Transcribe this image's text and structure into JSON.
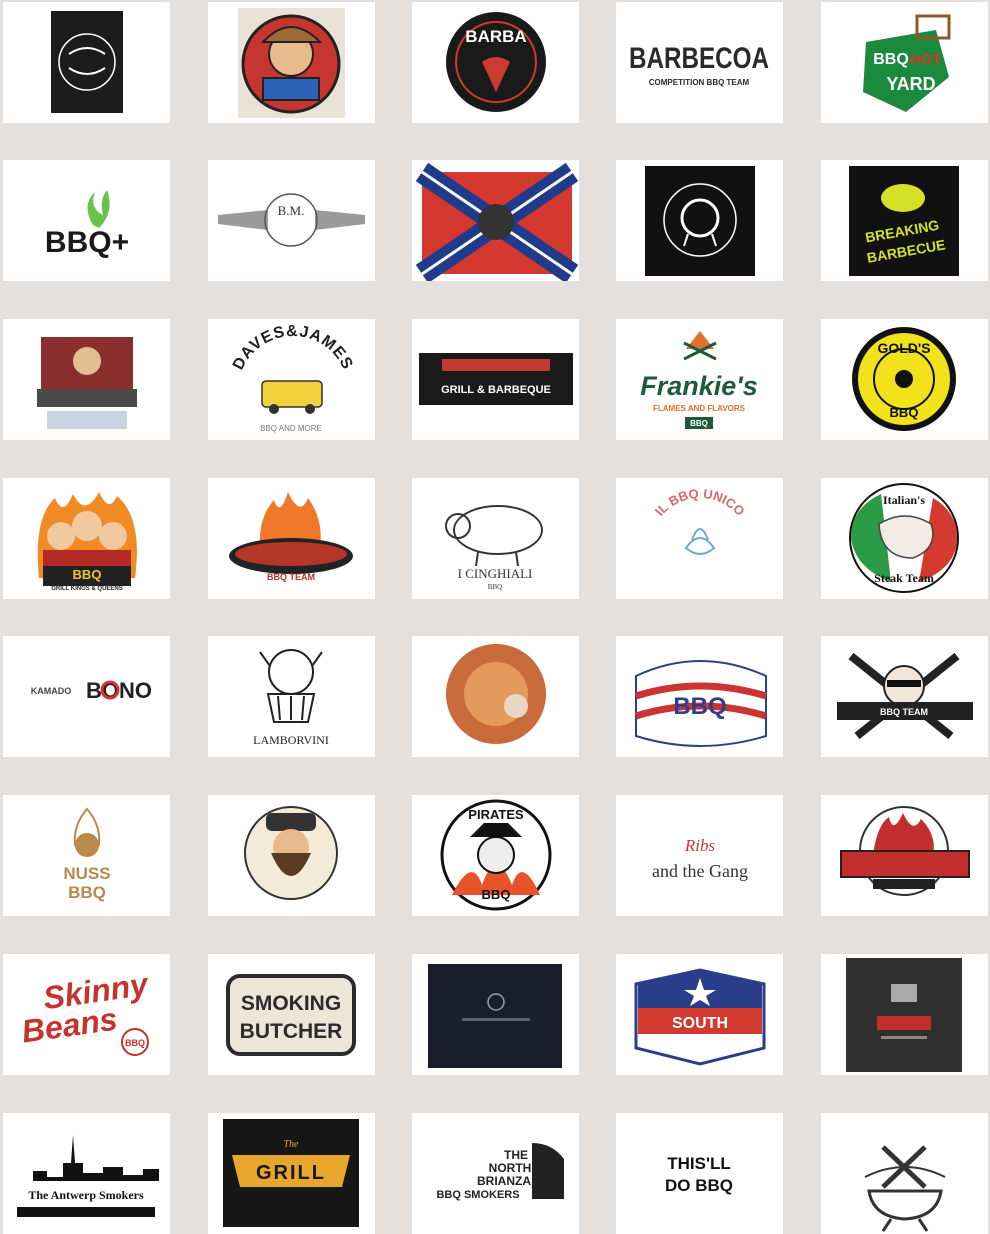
{
  "logos": [
    {
      "id": "the-rusty-grill",
      "text": "",
      "sub": ""
    },
    {
      "id": "pit-cartoon",
      "text": "",
      "sub": ""
    },
    {
      "id": "barba",
      "text": "BARBA",
      "sub": ""
    },
    {
      "id": "barbecoa",
      "text": "BARBECOA",
      "sub": "COMPETITION BBQ TEAM"
    },
    {
      "id": "bbq-hot-yard",
      "text": "BBQ",
      "sub": "HOT",
      "sub2": "YARD"
    },
    {
      "id": "bbq-plus",
      "text": "BBQ+",
      "sub": ""
    },
    {
      "id": "bm-wings",
      "text": "B.M.",
      "sub": ""
    },
    {
      "id": "flag-bbq",
      "text": "",
      "sub": ""
    },
    {
      "id": "brace-kettle",
      "text": "",
      "sub": ""
    },
    {
      "id": "breaking-barbecue",
      "text": "BREAKING",
      "sub": "BARBECUE"
    },
    {
      "id": "charcoal-crew",
      "text": "",
      "sub": ""
    },
    {
      "id": "daves-james",
      "text": "DAVES&JAMES",
      "sub": "BBQ AND MORE"
    },
    {
      "id": "grill-barbeque",
      "text": "",
      "sub": "GRILL & BARBEQUE"
    },
    {
      "id": "frankies",
      "text": "Frankie's",
      "sub": "FLAMES AND FLAVORS",
      "sub2": "BBQ"
    },
    {
      "id": "golds-bbq",
      "text": "GOLD'S",
      "sub": "BBQ"
    },
    {
      "id": "grill-kings-queens",
      "text": "BBQ",
      "sub": "GRILL KINGS & QUEENS"
    },
    {
      "id": "grill-unchained",
      "text": "",
      "sub": "BBQ TEAM"
    },
    {
      "id": "i-cinghiali",
      "text": "I CINGHIALI",
      "sub": "BBQ"
    },
    {
      "id": "il-bbq-unico",
      "text": "IL BBQ UNICO",
      "sub": ""
    },
    {
      "id": "italians-steak-team",
      "text": "Italian's",
      "sub": "Steak Team"
    },
    {
      "id": "kamado-bono",
      "text": "KAMADO",
      "sub": "BONO"
    },
    {
      "id": "lamborvini",
      "text": "LAMBORVINI",
      "sub": ""
    },
    {
      "id": "round-photo",
      "text": "",
      "sub": ""
    },
    {
      "id": "usa-bbq",
      "text": "BBQ",
      "sub": ""
    },
    {
      "id": "spatula-team",
      "text": "",
      "sub": "BBQ TEAM"
    },
    {
      "id": "nuss-bbq",
      "text": "NUSS",
      "sub": "BBQ"
    },
    {
      "id": "bearded-man",
      "text": "",
      "sub": ""
    },
    {
      "id": "pirates-bbq",
      "text": "PIRATES",
      "sub": "BBQ"
    },
    {
      "id": "ribs-gang",
      "text": "Ribs",
      "sub": "and the Gang"
    },
    {
      "id": "red-fire-team",
      "text": "",
      "sub": ""
    },
    {
      "id": "skinny-beans",
      "text": "Skinny",
      "sub": "Beans",
      "sub2": "BBQ"
    },
    {
      "id": "smoking-butcher",
      "text": "SMOKING",
      "sub": "BUTCHER"
    },
    {
      "id": "dark-card",
      "text": "",
      "sub": ""
    },
    {
      "id": "south-erbedia",
      "text": "SOUTH",
      "sub": ""
    },
    {
      "id": "dark-box",
      "text": "",
      "sub": ""
    },
    {
      "id": "antwerp-smokers",
      "text": "The Antwerp Smokers",
      "sub": ""
    },
    {
      "id": "the-grill",
      "text": "GRILL",
      "sub": "The"
    },
    {
      "id": "north-brianza",
      "text": "THE",
      "sub": "NORTH",
      "sub2": "BRIANZA",
      "sub3": "BBQ SMOKERS"
    },
    {
      "id": "thisll-do-bbq",
      "text": "THIS'LL",
      "sub": "DO BBQ"
    },
    {
      "id": "grill-tools",
      "text": "",
      "sub": ""
    }
  ]
}
